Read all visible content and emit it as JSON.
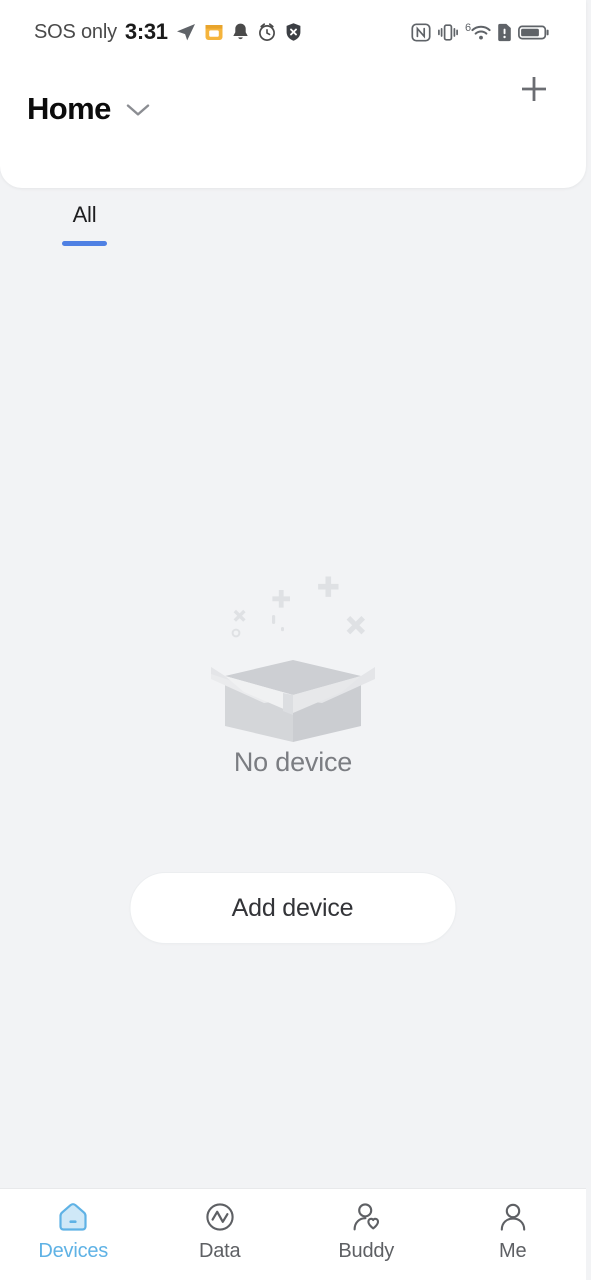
{
  "theme": {
    "page_bg": "#f2f3f5",
    "card_bg": "#ffffff",
    "tab_accent": "#4f80e3",
    "nav_active": "#5fb2e5",
    "text_primary": "#0c0c0c",
    "text_muted": "#7b7d82",
    "illustration_gray": "#d9dbde"
  },
  "status_bar": {
    "carrier": "SOS only",
    "time": "3:31",
    "left_icons": [
      "telegram-send-icon",
      "lock-orange-icon",
      "bell-icon",
      "alarm-clock-icon",
      "shield-x-icon"
    ],
    "right_icons": [
      "nfc-icon",
      "vibrate-icon",
      "wifi-6-icon",
      "sim-alert-icon",
      "battery-icon"
    ],
    "wifi_generation": "6"
  },
  "header": {
    "title": "Home",
    "dropdown_icon": "chevron-down-icon",
    "add_icon": "plus-icon",
    "add_label": "Add"
  },
  "tabs": [
    {
      "label": "All",
      "active": true
    }
  ],
  "empty_state": {
    "illustration": "empty-box-illustration",
    "text": "No device",
    "action_label": "Add device"
  },
  "bottom_nav": [
    {
      "label": "Devices",
      "icon": "home-house-icon",
      "active": true
    },
    {
      "label": "Data",
      "icon": "pulse-circle-icon",
      "active": false
    },
    {
      "label": "Buddy",
      "icon": "person-heart-icon",
      "active": false
    },
    {
      "label": "Me",
      "icon": "person-icon",
      "active": false
    }
  ]
}
